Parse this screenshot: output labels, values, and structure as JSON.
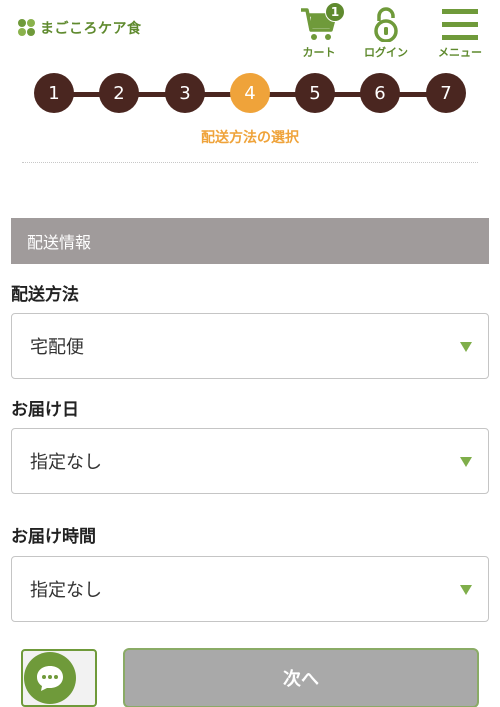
{
  "header": {
    "logo_text": "まごころケア食",
    "cart_label": "カート",
    "cart_count": "1",
    "login_label": "ログイン",
    "menu_label": "メニュー"
  },
  "steps": {
    "items": [
      "1",
      "2",
      "3",
      "4",
      "5",
      "6",
      "7"
    ],
    "current": 4,
    "current_label": "配送方法の選択"
  },
  "section": {
    "title": "配送情報"
  },
  "fields": {
    "delivery_method": {
      "label": "配送方法",
      "value": "宅配便"
    },
    "delivery_date": {
      "label": "お届け日",
      "value": "指定なし"
    },
    "delivery_time": {
      "label": "お届け時間",
      "value": "指定なし"
    }
  },
  "actions": {
    "next_label": "次へ"
  },
  "colors": {
    "brand_green": "#6f9a3a",
    "step_dark": "#4a2620",
    "step_active": "#efa33a",
    "section_gray": "#a09b9b",
    "next_button_gray": "#a9a9a9"
  },
  "icons": {
    "cart": "cart-icon",
    "login": "lock-icon",
    "menu": "hamburger-icon",
    "select_arrow": "triangle-down-icon",
    "chat": "chat-bubble-icon"
  }
}
